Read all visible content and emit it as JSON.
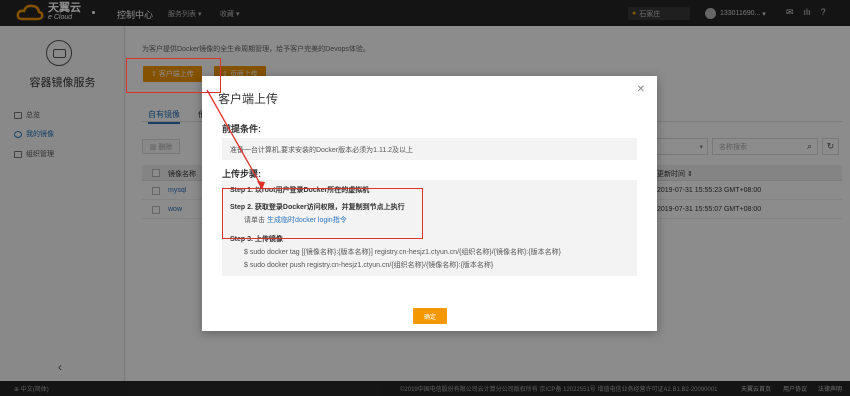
{
  "brand": {
    "name_cn": "天翼云",
    "name_en": "e Cloud"
  },
  "topnav": {
    "console": "控制中心",
    "services": "服务列表 ▾",
    "favorites": "收藏 ▾"
  },
  "region": "石家庄",
  "account": "133011690...",
  "sidebar": {
    "title": "容器镜像服务",
    "items": [
      {
        "label": "总览",
        "icon": "overview-icon"
      },
      {
        "label": "我的镜像",
        "icon": "user-icon",
        "active": true
      },
      {
        "label": "组织管理",
        "icon": "group-icon"
      }
    ],
    "collapse": "‹"
  },
  "main": {
    "intro": "为客户提供Docker镜像的全生命周期管理，给予客户完美的Devops体验。",
    "btn_client_upload": "客户端上传",
    "btn_page_upload": "页面上传",
    "tabs": [
      "自有镜像",
      "他"
    ],
    "btn_delete": "删除",
    "search_placeholder": "名称搜索",
    "columns": {
      "name": "镜像名称",
      "updated": "更新时间"
    },
    "rows": [
      {
        "name": "mysql",
        "updated": "2019-07-31 15:55:23 GMT+08:00"
      },
      {
        "name": "wow",
        "updated": "2019-07-31 15:55:07 GMT+08:00"
      }
    ]
  },
  "modal": {
    "title": "客户端上传",
    "prereq_heading": "前提条件:",
    "prereq_text": "准备一台计算机,要求安装的Docker版本必须为1.11.2及以上",
    "steps_heading": "上传步骤:",
    "step1": "Step 1. 以root用户登录Docker所在的虚拟机",
    "step2": "Step 2. 获取登录Docker访问权限，并复制到节点上执行",
    "step2_prefix": "请单击 ",
    "step2_link": "生成临时docker login指令",
    "step3": "Step 3. 上传镜像",
    "cmd1": "$ sudo docker tag [{镜像名称}:{版本名称}] registry.cn-hesjz1.ctyun.cn/{组织名称}/{镜像名称}:{版本名称}",
    "cmd2": "$ sudo docker push registry.cn-hesjz1.ctyun.cn/{组织名称}/{镜像名称}:{版本名称}",
    "confirm": "确定"
  },
  "footer": {
    "lang": "中文(简体)",
    "copyright": "©2019中国电信股份有限公司云计算分公司版权所有  京ICP备 12022551号  增值电信业务经营许可证A2.B1.B2-20090001",
    "links": [
      "天翼云首页",
      "用户协议",
      "法律声明"
    ]
  }
}
